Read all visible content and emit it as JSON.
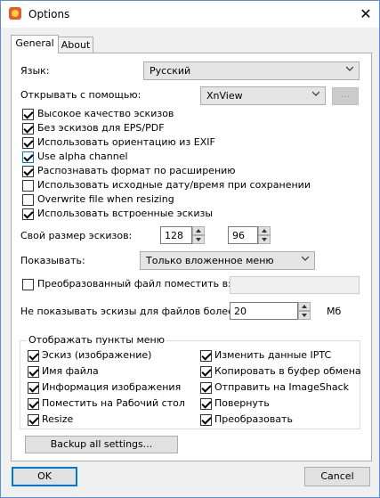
{
  "window": {
    "title": "Options"
  },
  "tabs": [
    {
      "label": "General"
    },
    {
      "label": "About"
    }
  ],
  "general": {
    "language": {
      "label": "Язык:",
      "value": "Русский"
    },
    "open_with": {
      "label": "Открывать с помощью:",
      "value": "XnView",
      "browse_label": "..."
    },
    "checkboxes": [
      {
        "label": "Высокое качество эскизов",
        "checked": true
      },
      {
        "label": "Без эскизов для EPS/PDF",
        "checked": true
      },
      {
        "label": "Использовать ориентацию из EXIF",
        "checked": true
      },
      {
        "label": "Use alpha channel",
        "checked": true
      },
      {
        "label": "Распознавать формат по расширению",
        "checked": true
      },
      {
        "label": "Использовать исходные дату/время при сохранении",
        "checked": false
      },
      {
        "label": "Overwrite file when resizing",
        "checked": false
      },
      {
        "label": "Использовать встроенные эскизы",
        "checked": true
      }
    ],
    "thumb_size": {
      "label": "Свой размер эскизов:",
      "width": "128",
      "height": "96"
    },
    "show": {
      "label": "Показывать:",
      "value": "Только вложенное меню"
    },
    "converted": {
      "label": "Преобразованный файл поместить в:",
      "checked": false,
      "value": ""
    },
    "max_size": {
      "label": "Не показывать эскизы для файлов более:",
      "value": "20",
      "unit": "Мб"
    },
    "menu_group": {
      "title": "Отображать пункты меню",
      "left": [
        {
          "label": "Эскиз (изображение)",
          "checked": true
        },
        {
          "label": "Имя файла",
          "checked": true
        },
        {
          "label": "Информация изображения",
          "checked": true
        },
        {
          "label": "Поместить на Рабочий стол",
          "checked": true
        },
        {
          "label": "Resize",
          "checked": true
        }
      ],
      "right": [
        {
          "label": "Изменить данные IPTC",
          "checked": true
        },
        {
          "label": "Копировать в буфер обмена",
          "checked": true
        },
        {
          "label": "Отправить на ImageShack",
          "checked": true
        },
        {
          "label": "Повернуть",
          "checked": true
        },
        {
          "label": "Преобразовать",
          "checked": true
        }
      ]
    },
    "backup_label": "Backup all settings..."
  },
  "footer": {
    "ok_label": "OK",
    "cancel_label": "Cancel"
  }
}
